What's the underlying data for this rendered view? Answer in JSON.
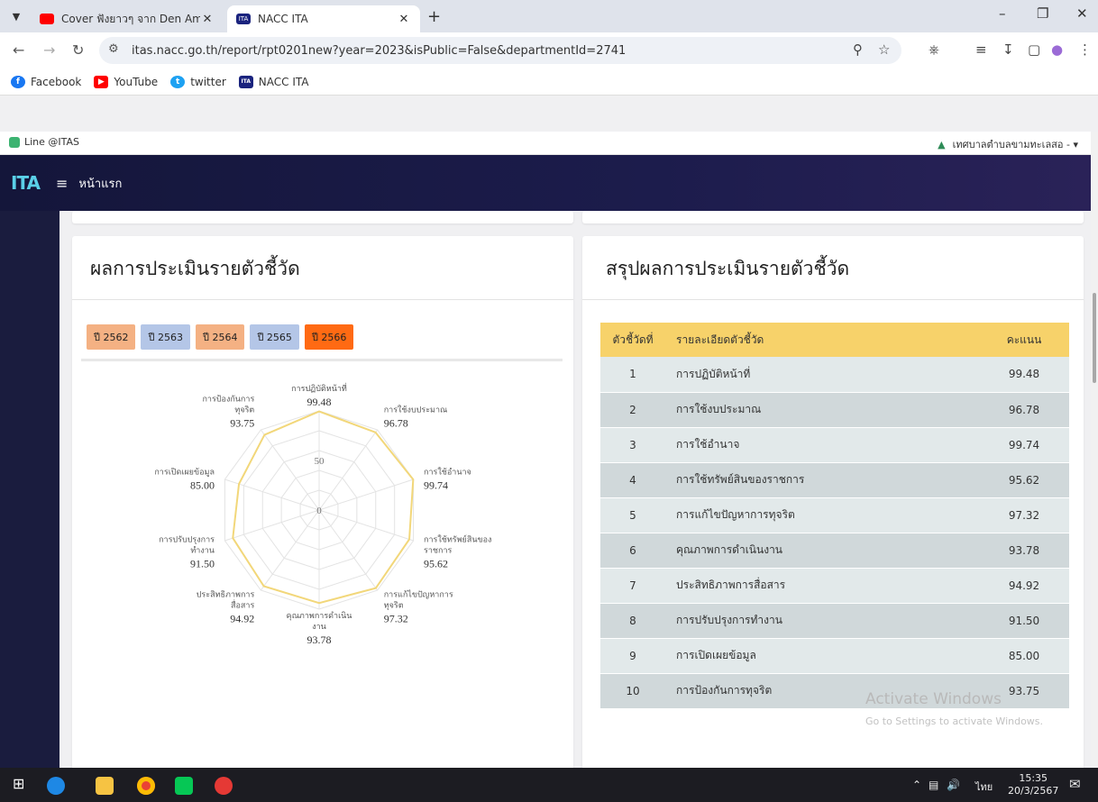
{
  "browser": {
    "tabs": [
      {
        "title": "Cover ฟังยาวๆ จาก Den Am The [",
        "active": false
      },
      {
        "title": "NACC ITA",
        "active": true
      }
    ],
    "tab_favicon_itas": "ITA",
    "url": "itas.nacc.go.th/report/rpt0201new?year=2023&isPublic=False&departmentId=2741",
    "bookmarks": [
      {
        "label": "Facebook",
        "icon": "facebook-icon",
        "color": "#1877f2"
      },
      {
        "label": "YouTube",
        "icon": "youtube-icon",
        "color": "#ff0000"
      },
      {
        "label": "twitter",
        "icon": "twitter-icon",
        "color": "#1da1f2"
      },
      {
        "label": "NACC ITA",
        "icon": "nacc-ita-icon",
        "color": "#1a237e"
      }
    ]
  },
  "topstrip": {
    "line_label": "Line @ITAS",
    "user_label": "เทศบาลตำบลขามทะเลสอ - ▾"
  },
  "navbar": {
    "logo": "ITA",
    "home_label": "หน้าแรก"
  },
  "left_card": {
    "title": "ผลการประเมินรายตัวชี้วัด",
    "years": [
      {
        "label": "ปี 2562",
        "color": "#f4b183"
      },
      {
        "label": "ปี 2563",
        "color": "#b4c6e7"
      },
      {
        "label": "ปี 2564",
        "color": "#f4b183"
      },
      {
        "label": "ปี 2565",
        "color": "#b4c6e7"
      },
      {
        "label": "ปี 2566",
        "color": "#ff6a13",
        "selected": true
      }
    ]
  },
  "chart_data": {
    "type": "radar",
    "axis_ticks": [
      "0",
      "50"
    ],
    "rmax": 100,
    "series_color": "#f2d77a",
    "axes": [
      {
        "label": [
          "การปฏิบัติหน้าที่"
        ],
        "value": 99.48
      },
      {
        "label": [
          "การใช้งบประมาณ"
        ],
        "value": 96.78
      },
      {
        "label": [
          "การใช้อำนาจ"
        ],
        "value": 99.74
      },
      {
        "label": [
          "การใช้ทรัพย์สินของ",
          "ราชการ"
        ],
        "value": 95.62
      },
      {
        "label": [
          "การแก้ไขปัญหาการ",
          "ทุจริต"
        ],
        "value": 97.32
      },
      {
        "label": [
          "คุณภาพการดำเนิน",
          "งาน"
        ],
        "value": 93.78
      },
      {
        "label": [
          "ประสิทธิภาพการ",
          "สื่อสาร"
        ],
        "value": 94.92
      },
      {
        "label": [
          "การปรับปรุงการ",
          "ทำงาน"
        ],
        "value": 91.5
      },
      {
        "label": [
          "การเปิดเผยข้อมูล"
        ],
        "value": 85.0
      },
      {
        "label": [
          "การป้องกันการ",
          "ทุจริต"
        ],
        "value": 93.75
      }
    ]
  },
  "right_card": {
    "title": "สรุปผลการประเมินรายตัวชี้วัด",
    "headers": [
      "ตัวชี้วัดที่",
      "รายละเอียดตัวชี้วัด",
      "คะแนน"
    ],
    "rows": [
      [
        "1",
        "การปฏิบัติหน้าที่",
        "99.48"
      ],
      [
        "2",
        "การใช้งบประมาณ",
        "96.78"
      ],
      [
        "3",
        "การใช้อำนาจ",
        "99.74"
      ],
      [
        "4",
        "การใช้ทรัพย์สินของราชการ",
        "95.62"
      ],
      [
        "5",
        "การแก้ไขปัญหาการทุจริต",
        "97.32"
      ],
      [
        "6",
        "คุณภาพการดำเนินงาน",
        "93.78"
      ],
      [
        "7",
        "ประสิทธิภาพการสื่อสาร",
        "94.92"
      ],
      [
        "8",
        "การปรับปรุงการทำงาน",
        "91.50"
      ],
      [
        "9",
        "การเปิดเผยข้อมูล",
        "85.00"
      ],
      [
        "10",
        "การป้องกันการทุจริต",
        "93.75"
      ]
    ]
  },
  "watermark": {
    "line1": "Activate Windows",
    "line2": "Go to Settings to activate Windows."
  },
  "taskbar": {
    "lang": "ไทย",
    "time": "15:35",
    "date": "20/3/2567"
  }
}
